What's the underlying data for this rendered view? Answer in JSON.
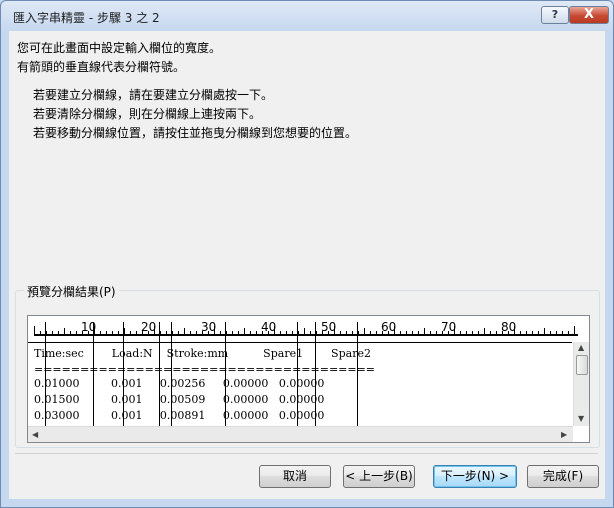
{
  "window": {
    "title": "匯入字串精靈 - 步驟 3 之 2",
    "help_label": "?",
    "close_label": "X"
  },
  "intro": {
    "line1": "您可在此畫面中設定輸入欄位的寬度。",
    "line2": "有箭頭的垂直線代表分欄符號。"
  },
  "instructions": [
    "若要建立分欄線，請在要建立分欄處按一下。",
    "若要清除分欄線，則在分欄線上連按兩下。",
    "若要移動分欄線位置，請按住並拖曳分欄線到您想要的位置。"
  ],
  "preview": {
    "label": "預覽分欄結果(P)",
    "ruler_labels": [
      "10",
      "20",
      "30",
      "40",
      "50",
      "60",
      "70",
      "80"
    ],
    "lines": [
      "Time:sec        Load:N    Stroke:mm          Spare1        Spare2",
      "=======================================================",
      "0.01000         0.001     0.00256     0.00000   0.00000",
      "0.01500         0.001     0.00509     0.00000   0.00000",
      "0.03000         0.001     0.00891     0.00000   0.00000"
    ],
    "column_break_count": 9
  },
  "buttons": {
    "cancel": "取消",
    "back": "< 上一步(B)",
    "next": "下一步(N) >",
    "finish": "完成(F)"
  }
}
